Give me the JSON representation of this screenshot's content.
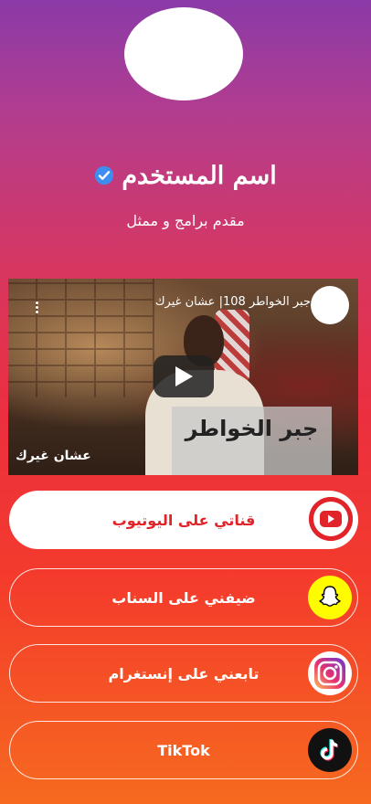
{
  "profile": {
    "name": "اسم المستخدم",
    "bio": "مقدم برامج و ممثل",
    "verified_color": "#3d8ef0"
  },
  "video": {
    "title": "جبر الخواطر 108| عشان غيرك",
    "overlay_text": "جبر الخواطر",
    "watermark": "عشان غيرك"
  },
  "links": [
    {
      "label": "قناتي على اليوتيوب",
      "icon": "youtube-icon",
      "style": "solid"
    },
    {
      "label": "ضيفني على السناب",
      "icon": "snapchat-icon",
      "style": "outline"
    },
    {
      "label": "تابعني على إنستغرام",
      "icon": "instagram-icon",
      "style": "outline"
    },
    {
      "label": "TikTok",
      "icon": "tiktok-icon",
      "style": "outline"
    }
  ],
  "colors": {
    "youtube": "#ff0000",
    "snapchat": "#fffc00",
    "accent_red": "#e0242a"
  }
}
